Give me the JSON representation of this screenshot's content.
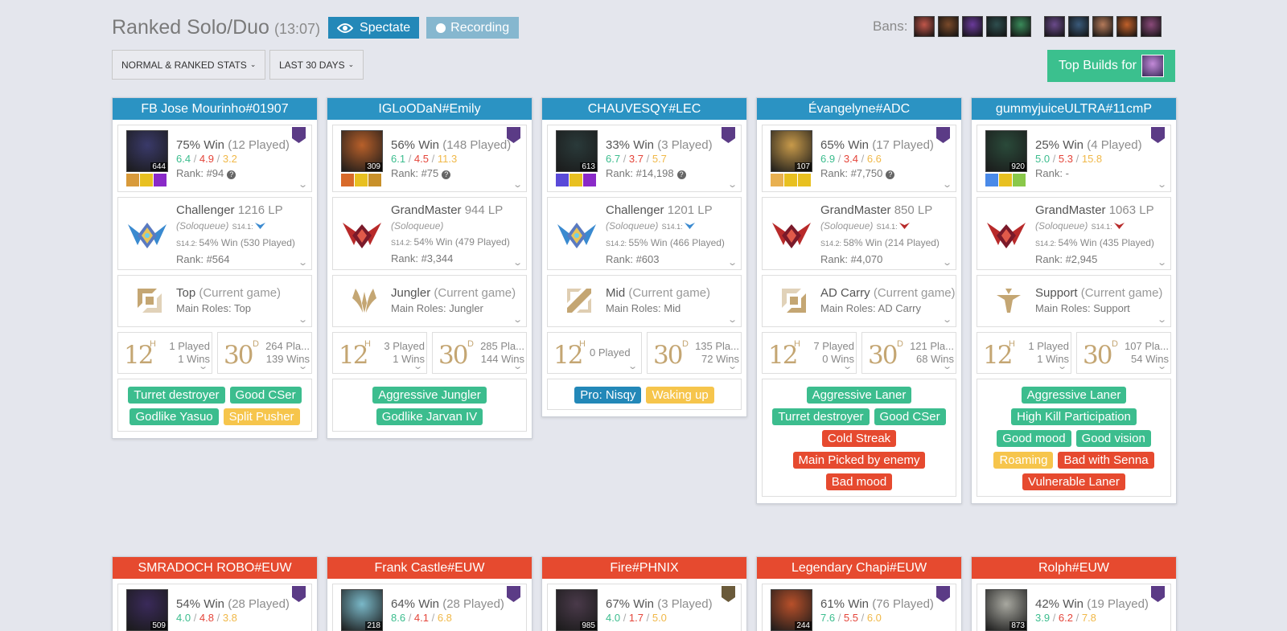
{
  "header": {
    "title": "Ranked Solo/Duo",
    "time": "(13:07)",
    "spectate_label": "Spectate",
    "recording_label": "Recording",
    "bans_label": "Bans:",
    "bans_blue": [
      "#c0564a",
      "#7a4a2a",
      "#6a3a9a",
      "#2e4e4e",
      "#3a8a5a"
    ],
    "bans_red": [
      "#6a4a8a",
      "#3a5a7a",
      "#b47a5a",
      "#c0602a",
      "#8a4a7a"
    ]
  },
  "filters": {
    "stats_label": "NORMAL & RANKED STATS",
    "period_label": "LAST 30 DAYS",
    "top_builds_label": "Top Builds for"
  },
  "blue_team": [
    {
      "name": "FB Jose Mourinho#01907",
      "champ_color": "#3a3a6a",
      "champ_level": "644",
      "win": "75% Win",
      "played": "(12 Played)",
      "k": "6.4",
      "d": "4.9",
      "a": "3.2",
      "rank": "Rank: #94",
      "tier": "Challenger",
      "lp": "1216 LP",
      "queue": "(Soloqueue)",
      "s141": "S14.1:",
      "s142": "S14.2:",
      "season_win": "54% Win (530 Played)",
      "league_rank": "Rank: #564",
      "emblem": "challenger",
      "role": "Top",
      "role_current": "(Current game)",
      "main_roles": "Main Roles: Top",
      "role_icon": "top",
      "h12": "1 Played",
      "h12b": "1 Wins",
      "d30": "264 Pla...",
      "d30b": "139 Wins",
      "tags": [
        {
          "label": "Turret destroyer",
          "color": "green"
        },
        {
          "label": "Good CSer",
          "color": "green"
        },
        {
          "label": "Godlike Yasuo",
          "color": "green"
        },
        {
          "label": "Split Pusher",
          "color": "yellow"
        }
      ]
    },
    {
      "name": "IGLoODaN#Emily",
      "champ_color": "#b8602a",
      "champ_level": "309",
      "win": "56% Win",
      "played": "(148 Played)",
      "k": "6.1",
      "d": "4.5",
      "a": "11.3",
      "rank": "Rank: #75",
      "tier": "GrandMaster",
      "lp": "944 LP",
      "queue": "(Soloqueue)",
      "s141": "",
      "s142": "S14.2:",
      "season_win": "54% Win (479 Played)",
      "league_rank": "Rank: #3,344",
      "emblem": "grandmaster",
      "role": "Jungler",
      "role_current": "(Current game)",
      "main_roles": "Main Roles: Jungler",
      "role_icon": "jungle",
      "h12": "3 Played",
      "h12b": "1 Wins",
      "d30": "285 Pla...",
      "d30b": "144 Wins",
      "tags": [
        {
          "label": "Aggressive Jungler",
          "color": "green"
        },
        {
          "label": "Godlike Jarvan IV",
          "color": "green"
        }
      ]
    },
    {
      "name": "CHAUVESQY#LEC",
      "champ_color": "#2a3a3a",
      "champ_level": "613",
      "win": "33% Win",
      "played": "(3 Played)",
      "k": "6.7",
      "d": "3.7",
      "a": "5.7",
      "rank": "Rank: #14,198",
      "tier": "Challenger",
      "lp": "1201 LP",
      "queue": "(Soloqueue)",
      "s141": "S14.1:",
      "s142": "S14.2:",
      "season_win": "55% Win (466 Played)",
      "league_rank": "Rank: #603",
      "emblem": "challenger",
      "role": "Mid",
      "role_current": "(Current game)",
      "main_roles": "Main Roles: Mid",
      "role_icon": "mid",
      "h12": "0 Played",
      "h12b": "",
      "d30": "135 Pla...",
      "d30b": "72 Wins",
      "tags": [
        {
          "label": "Pro: Nisqy",
          "color": "blue"
        },
        {
          "label": "Waking up",
          "color": "yellow"
        }
      ]
    },
    {
      "name": "Évangelyne#ADC",
      "champ_color": "#c89a4a",
      "champ_level": "107",
      "win": "65% Win",
      "played": "(17 Played)",
      "k": "6.9",
      "d": "3.4",
      "a": "6.6",
      "rank": "Rank: #7,750",
      "tier": "GrandMaster",
      "lp": "850 LP",
      "queue": "(Soloqueue)",
      "s141": "S14.1:",
      "s142": "S14.2:",
      "season_win": "58% Win (214 Played)",
      "league_rank": "Rank: #4,070",
      "emblem": "grandmaster",
      "role": "AD Carry",
      "role_current": "(Current game)",
      "main_roles": "Main Roles: AD Carry",
      "role_icon": "bot",
      "h12": "7 Played",
      "h12b": "0 Wins",
      "d30": "121 Pla...",
      "d30b": "68 Wins",
      "tags": [
        {
          "label": "Aggressive Laner",
          "color": "green"
        },
        {
          "label": "Turret destroyer",
          "color": "green"
        },
        {
          "label": "Good CSer",
          "color": "green"
        },
        {
          "label": "Cold Streak",
          "color": "red"
        },
        {
          "label": "Main Picked by enemy",
          "color": "red"
        },
        {
          "label": "Bad mood",
          "color": "red"
        }
      ]
    },
    {
      "name": "gummyjuiceULTRA#11cmP",
      "champ_color": "#2a4a3a",
      "champ_level": "920",
      "win": "25% Win",
      "played": "(4 Played)",
      "k": "5.0",
      "d": "5.3",
      "a": "15.8",
      "rank": "Rank: -",
      "tier": "GrandMaster",
      "lp": "1063 LP",
      "queue": "(Soloqueue)",
      "s141": "S14.1:",
      "s142": "S14.2:",
      "season_win": "54% Win (435 Played)",
      "league_rank": "Rank: #2,945",
      "emblem": "grandmaster",
      "role": "Support",
      "role_current": "(Current game)",
      "main_roles": "Main Roles: Support",
      "role_icon": "support",
      "h12": "1 Played",
      "h12b": "1 Wins",
      "d30": "107 Pla...",
      "d30b": "54 Wins",
      "tags": [
        {
          "label": "Aggressive Laner",
          "color": "green"
        },
        {
          "label": "High Kill Participation",
          "color": "green"
        },
        {
          "label": "Good mood",
          "color": "green"
        },
        {
          "label": "Good vision",
          "color": "green"
        },
        {
          "label": "Roaming",
          "color": "yellow"
        },
        {
          "label": "Bad with Senna",
          "color": "red"
        },
        {
          "label": "Vulnerable Laner",
          "color": "red"
        }
      ]
    }
  ],
  "red_team": [
    {
      "name": "SMRADOCH ROBO#EUW",
      "champ_color": "#3a2a5a",
      "champ_level": "509",
      "win": "54% Win",
      "played": "(28 Played)",
      "k": "4.0",
      "d": "4.8",
      "a": "3.8"
    },
    {
      "name": "Frank Castle#EUW",
      "champ_color": "#7ab8c8",
      "champ_level": "218",
      "win": "64% Win",
      "played": "(28 Played)",
      "k": "8.6",
      "d": "4.1",
      "a": "6.8"
    },
    {
      "name": "Fire#PHNIX",
      "champ_color": "#4a3a4a",
      "champ_level": "985",
      "win": "67% Win",
      "played": "(3 Played)",
      "k": "4.0",
      "d": "1.7",
      "a": "5.0"
    },
    {
      "name": "Legendary Chapi#EUW",
      "champ_color": "#b8502a",
      "champ_level": "244",
      "win": "61% Win",
      "played": "(76 Played)",
      "k": "7.6",
      "d": "5.5",
      "a": "6.0"
    },
    {
      "name": "Rolph#EUW",
      "champ_color": "#a8a8a0",
      "champ_level": "873",
      "win": "42% Win",
      "played": "(19 Played)",
      "k": "3.9",
      "d": "6.2",
      "a": "7.8"
    }
  ]
}
